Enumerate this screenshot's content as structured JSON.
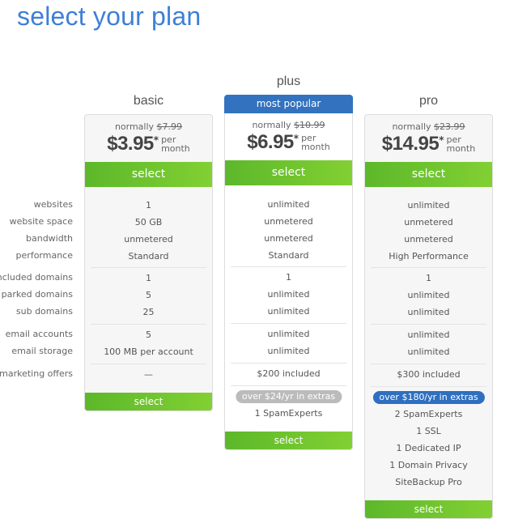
{
  "page": {
    "title": "select your plan"
  },
  "row_labels": [
    "websites",
    "website space",
    "bandwidth",
    "performance",
    "included domains",
    "parked domains",
    "sub domains",
    "email accounts",
    "email storage",
    "marketing offers"
  ],
  "plans": [
    {
      "name": "basic",
      "normally_label": "normally",
      "old_price": "$7.99",
      "price": "$3.95",
      "asterisk": "*",
      "per": "per",
      "month": "month",
      "select_label": "select",
      "values": [
        "1",
        "50 GB",
        "unmetered",
        "Standard",
        "1",
        "5",
        "25",
        "5",
        "100 MB per account",
        "—"
      ],
      "extras_badge": "",
      "extras": []
    },
    {
      "name": "plus",
      "badge": "most popular",
      "normally_label": "normally",
      "old_price": "$10.99",
      "price": "$6.95",
      "asterisk": "*",
      "per": "per",
      "month": "month",
      "select_label": "select",
      "values": [
        "unlimited",
        "unmetered",
        "unmetered",
        "Standard",
        "1",
        "unlimited",
        "unlimited",
        "unlimited",
        "unlimited",
        "$200 included"
      ],
      "extras_badge": "over $24/yr in extras",
      "extras": [
        "1 SpamExperts"
      ]
    },
    {
      "name": "pro",
      "normally_label": "normally",
      "old_price": "$23.99",
      "price": "$14.95",
      "asterisk": "*",
      "per": "per",
      "month": "month",
      "select_label": "select",
      "values": [
        "unlimited",
        "unmetered",
        "unmetered",
        "High Performance",
        "1",
        "unlimited",
        "unlimited",
        "unlimited",
        "unlimited",
        "$300 included"
      ],
      "extras_badge": "over $180/yr in extras",
      "extras": [
        "2 SpamExperts",
        "1 SSL",
        "1 Dedicated IP",
        "1 Domain Privacy",
        "SiteBackup Pro"
      ]
    }
  ],
  "colors": {
    "title_blue": "#3e7fd7",
    "popular_blue": "#3372bf",
    "select_green_start": "#5cb82a",
    "select_green_end": "#82d033",
    "pill_gray": "#bbbbbb",
    "pill_blue": "#2f6fc0"
  }
}
